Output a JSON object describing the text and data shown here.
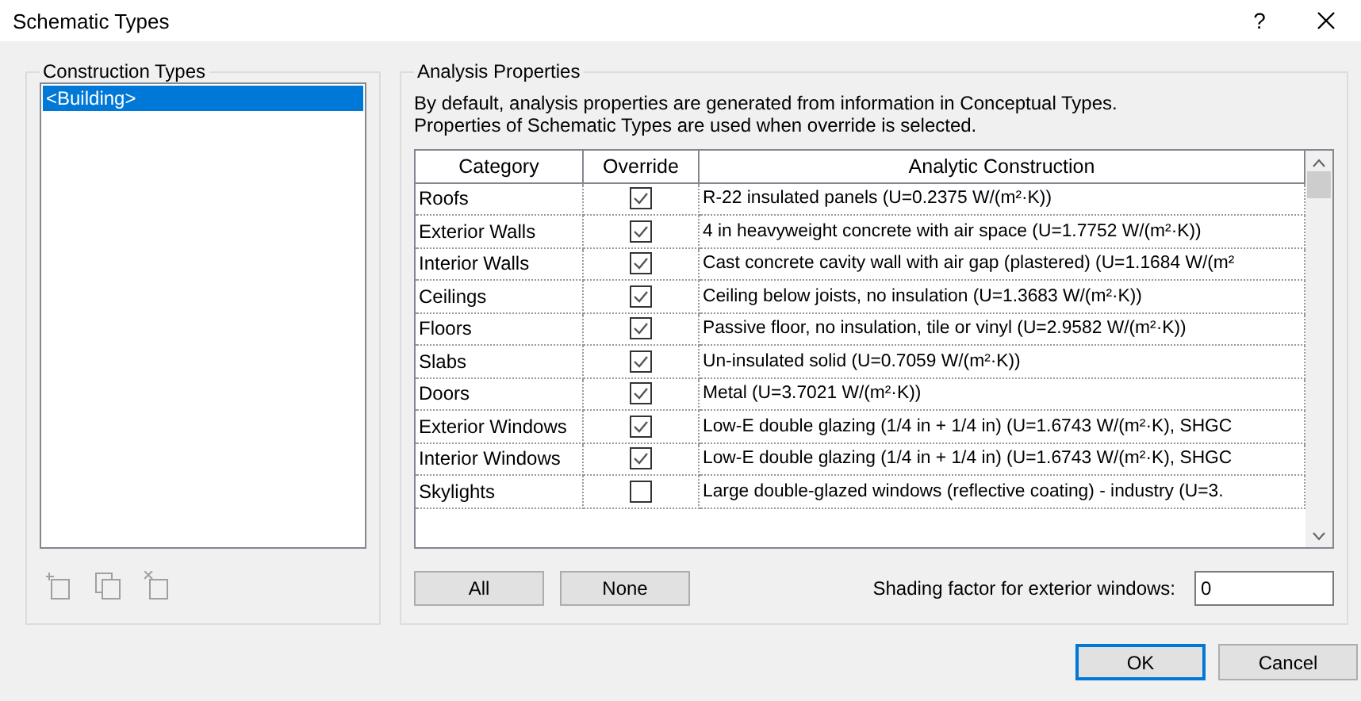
{
  "window": {
    "title": "Schematic Types",
    "help": "?"
  },
  "construction_types": {
    "title": "Construction Types",
    "items": [
      {
        "label": "<Building>",
        "selected": true
      }
    ]
  },
  "analysis_properties": {
    "title": "Analysis Properties",
    "description": "By default, analysis properties are generated from information in Conceptual Types.\nProperties of Schematic Types are used when override is selected.",
    "table": {
      "columns": [
        "Category",
        "Override",
        "Analytic Construction"
      ],
      "rows": [
        {
          "category": "Roofs",
          "override": true,
          "construction": "R-22 insulated panels (U=0.2375 W/(m²·K))"
        },
        {
          "category": "Exterior Walls",
          "override": true,
          "construction": "4 in heavyweight concrete with air space (U=1.7752 W/(m²·K))"
        },
        {
          "category": "Interior Walls",
          "override": true,
          "construction": "Cast concrete cavity wall with air gap (plastered) (U=1.1684 W/(m²"
        },
        {
          "category": "Ceilings",
          "override": true,
          "construction": "Ceiling below joists, no insulation (U=1.3683 W/(m²·K))"
        },
        {
          "category": "Floors",
          "override": true,
          "construction": "Passive floor, no insulation, tile or vinyl (U=2.9582 W/(m²·K))"
        },
        {
          "category": "Slabs",
          "override": true,
          "construction": "Un-insulated solid (U=0.7059 W/(m²·K))"
        },
        {
          "category": "Doors",
          "override": true,
          "construction": "Metal (U=3.7021 W/(m²·K))"
        },
        {
          "category": "Exterior Windows",
          "override": true,
          "construction": "Low-E double glazing (1/4 in + 1/4 in) (U=1.6743 W/(m²·K), SHGC"
        },
        {
          "category": "Interior Windows",
          "override": true,
          "construction": "Low-E double glazing (1/4 in + 1/4 in) (U=1.6743 W/(m²·K), SHGC"
        },
        {
          "category": "Skylights",
          "override": false,
          "construction": "Large double-glazed windows (reflective coating) - industry (U=3."
        }
      ]
    },
    "buttons": [
      "All",
      "None"
    ],
    "shading": {
      "label": "Shading factor for exterior windows:",
      "value": "0"
    }
  },
  "buttons": [
    {
      "label": "OK",
      "kind": "default"
    },
    {
      "label": "Cancel",
      "kind": "normal"
    }
  ]
}
